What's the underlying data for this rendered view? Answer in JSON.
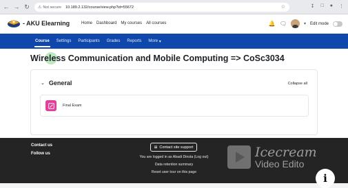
{
  "browser": {
    "not_secure": "Not secure",
    "url": "10.189.2.132/course/view.php?id=55672"
  },
  "header": {
    "logo_text": "AKU Elearning",
    "nav": [
      "Home",
      "Dashboard",
      "My courses",
      "All courses"
    ],
    "edit_mode": "Edit mode"
  },
  "course_nav": {
    "items": [
      "Course",
      "Settings",
      "Participants",
      "Grades",
      "Reports",
      "More"
    ],
    "active": "Course"
  },
  "page": {
    "title": "Wireless Communication and Mobile Computing => CoSc3034",
    "section_title": "General",
    "collapse_label": "Collapse all",
    "activity_label": "Final Exam"
  },
  "footer": {
    "contact_us": "Contact us",
    "follow_us": "Follow us",
    "contact_button": "Contact site support",
    "logged_in": "You are logged in as Abadi Dinsta (Log out)",
    "data_retention": "Data retention summary",
    "reset_tour": "Reset user tour on this page"
  },
  "watermark": {
    "line1": "Icecream",
    "line2": "Video Edito"
  },
  "colors": {
    "brand_blue": "#0f47ad",
    "footer_bg": "#242424",
    "activity_icon": "#e0419b"
  }
}
